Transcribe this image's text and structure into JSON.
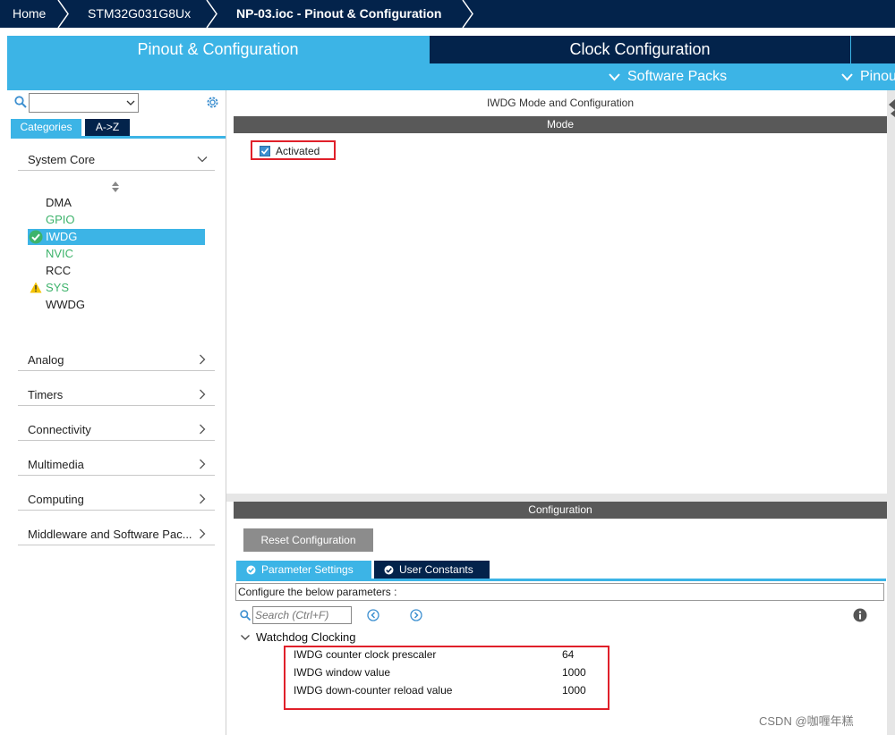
{
  "breadcrumb": {
    "home": "Home",
    "device": "STM32G031G8Ux",
    "file": "NP-03.ioc - Pinout & Configuration"
  },
  "tabs": {
    "pinout": "Pinout & Configuration",
    "clock": "Clock Configuration",
    "software_packs": "Software Packs",
    "pinout_view": "Pinou"
  },
  "sidebar": {
    "search_value": "",
    "tab_categories": "Categories",
    "tab_az": "A->Z",
    "system_core": {
      "label": "System Core",
      "items": [
        {
          "label": "DMA",
          "color": "#222222",
          "status": ""
        },
        {
          "label": "GPIO",
          "color": "#3db36b",
          "status": ""
        },
        {
          "label": "IWDG",
          "color": "#ffffff",
          "status": "check"
        },
        {
          "label": "NVIC",
          "color": "#3db36b",
          "status": ""
        },
        {
          "label": "RCC",
          "color": "#222222",
          "status": ""
        },
        {
          "label": "SYS",
          "color": "#3db36b",
          "status": "warning"
        },
        {
          "label": "WWDG",
          "color": "#222222",
          "status": ""
        }
      ]
    },
    "categories": [
      "Analog",
      "Timers",
      "Connectivity",
      "Multimedia",
      "Computing",
      "Middleware and Software Pac..."
    ]
  },
  "main": {
    "title": "IWDG Mode and Configuration",
    "mode_header": "Mode",
    "activated_label": "Activated",
    "activated_checked": true,
    "config_header": "Configuration",
    "reset_button": "Reset Configuration",
    "param_tab": "Parameter Settings",
    "user_tab": "User Constants",
    "config_hint": "Configure the below parameters :",
    "search_placeholder": "Search (Ctrl+F)",
    "group": "Watchdog Clocking",
    "params": [
      {
        "name": "IWDG counter clock prescaler",
        "value": "64"
      },
      {
        "name": "IWDG window value",
        "value": "1000"
      },
      {
        "name": "IWDG down-counter reload value",
        "value": "1000"
      }
    ]
  },
  "watermark": "CSDN @咖喱年糕",
  "colors": {
    "navy": "#03234b",
    "accent": "#3cb4e6",
    "header_grey": "#595959",
    "highlight_red": "#e0202a"
  }
}
